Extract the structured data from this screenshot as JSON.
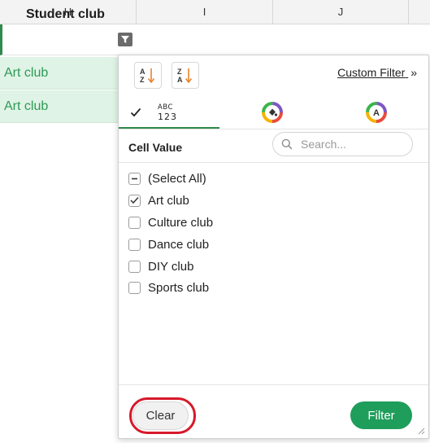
{
  "columns": [
    "H",
    "I",
    "J"
  ],
  "header_cell": {
    "text": "Student club"
  },
  "data_cells": [
    "Art club",
    "Art club"
  ],
  "popup": {
    "custom_filter_label": "Custom Filter",
    "custom_filter_chevron": "»",
    "tabs": {
      "values_top": "ABC",
      "values_bottom": "123",
      "fill_color_letter": "",
      "font_color_letter": "A"
    },
    "cell_value_label": "Cell Value",
    "search": {
      "placeholder": "Search..."
    },
    "items": [
      {
        "label": "(Select All)",
        "state": "indeterminate"
      },
      {
        "label": "Art club",
        "state": "checked"
      },
      {
        "label": "Culture club",
        "state": "unchecked"
      },
      {
        "label": "Dance club",
        "state": "unchecked"
      },
      {
        "label": "DIY club",
        "state": "unchecked"
      },
      {
        "label": "Sports club",
        "state": "unchecked"
      }
    ],
    "clear_label": "Clear",
    "filter_label": "Filter"
  },
  "colors": {
    "accent_green": "#1f9d5b",
    "cell_green_text": "#2e9a55",
    "cell_green_bg": "#dff3e6",
    "highlight_red": "#d6192a"
  }
}
